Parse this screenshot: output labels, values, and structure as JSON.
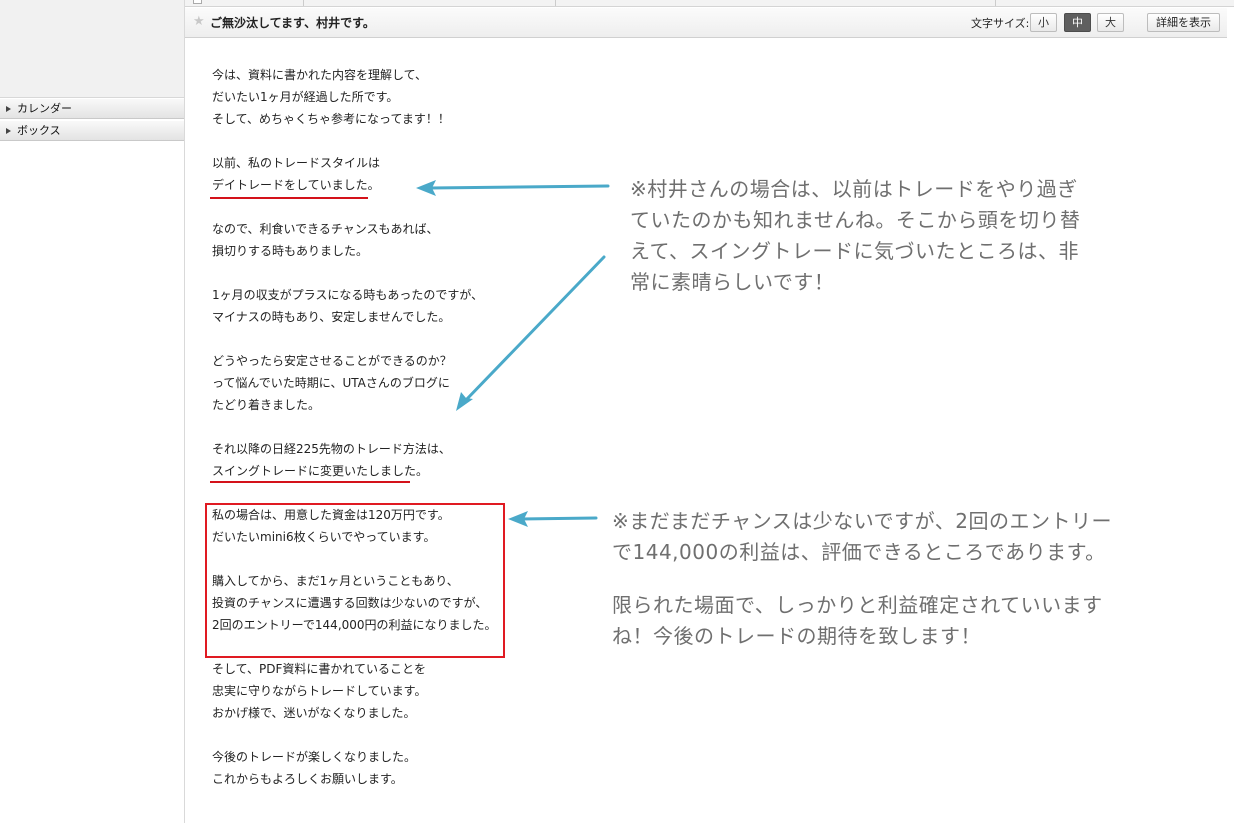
{
  "sidebar": {
    "items": [
      {
        "label": "カレンダー"
      },
      {
        "label": "ボックス"
      }
    ]
  },
  "header": {
    "subject": "ご無沙汰してます、村井です。",
    "font_size_label": "文字サイズ:",
    "font_sizes": [
      "小",
      "中",
      "大"
    ],
    "font_size_selected": "中",
    "detail_button": "詳細を表示"
  },
  "mail_body": {
    "paragraphs": [
      [
        "今は、資料に書かれた内容を理解して、",
        "だいたい1ヶ月が経過した所です。",
        "そして、めちゃくちゃ参考になってます！！"
      ],
      [
        "以前、私のトレードスタイルは",
        "デイトレードをしていました。"
      ],
      [
        "なので、利食いできるチャンスもあれば、",
        "損切りする時もありました。"
      ],
      [
        "1ヶ月の収支がプラスになる時もあったのですが、",
        "マイナスの時もあり、安定しませんでした。"
      ],
      [
        "どうやったら安定させることができるのか？",
        "って悩んでいた時期に、UTAさんのブログに",
        "たどり着きました。"
      ],
      [
        "それ以降の日経225先物のトレード方法は、",
        "スイングトレードに変更いたしました。"
      ],
      [
        "私の場合は、用意した資金は120万円です。",
        "だいたいmini6枚くらいでやっています。"
      ],
      [
        "購入してから、まだ1ヶ月ということもあり、",
        "投資のチャンスに遭遇する回数は少ないのですが、",
        "2回のエントリーで144,000円の利益になりました。"
      ],
      [
        "そして、PDF資料に書かれていることを",
        "忠実に守りながらトレードしています。",
        "おかげ様で、迷いがなくなりました。"
      ],
      [
        "今後のトレードが楽しくなりました。",
        "これからもよろしくお願いします。"
      ]
    ]
  },
  "annotations": {
    "note1": [
      "※村井さんの場合は、以前はトレードをやり過ぎ",
      "ていたのかも知れませんね。そこから頭を切り替",
      "えて、スイングトレードに気づいたところは、非",
      "常に素晴らしいです！"
    ],
    "note2": [
      "※まだまだチャンスは少ないですが、2回のエントリー",
      "で144,000の利益は、評価できるところであります。",
      "",
      "限られた場面で、しっかりと利益確定されていいます",
      "ね！今後のトレードの期待を致します！"
    ]
  },
  "colors": {
    "arrow": "#4aa9c9",
    "underline": "#d4121a",
    "box": "#e01a22",
    "annotation_text": "#6f6f6f"
  }
}
